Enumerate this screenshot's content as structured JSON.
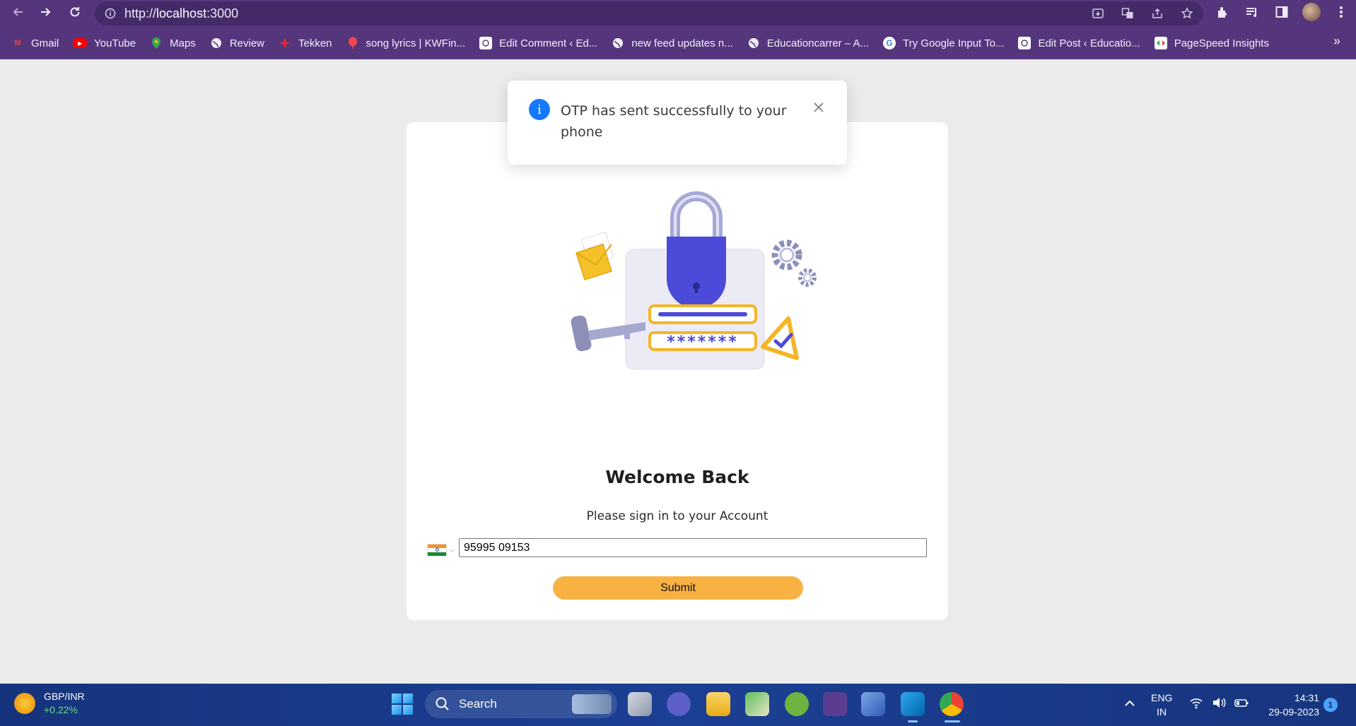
{
  "browser": {
    "url_scheme": "http://",
    "url_host": "localhost",
    "url_port": ":3000",
    "bookmarks": [
      {
        "label": "Gmail",
        "icon": "gmail-icon",
        "color": "#ea4335"
      },
      {
        "label": "YouTube",
        "icon": "youtube-icon",
        "color": "#ff0000"
      },
      {
        "label": "Maps",
        "icon": "maps-icon",
        "color": "#34a853"
      },
      {
        "label": "Review",
        "icon": "globe-icon",
        "color": "#ffffff"
      },
      {
        "label": "Tekken",
        "icon": "tekken-icon",
        "color": "#e3262e"
      },
      {
        "label": "song lyrics | KWFin...",
        "icon": "kwfinder-icon",
        "color": "#f2474f"
      },
      {
        "label": "Edit Comment ‹ Ed...",
        "icon": "site-icon",
        "color": "#ffffff"
      },
      {
        "label": "new feed updates n...",
        "icon": "globe-icon",
        "color": "#ffffff"
      },
      {
        "label": "Educationcarrer – A...",
        "icon": "globe-icon",
        "color": "#ffffff"
      },
      {
        "label": "Try Google Input To...",
        "icon": "google-icon",
        "color": "#ffffff"
      },
      {
        "label": "Edit Post ‹ Educatio...",
        "icon": "site-icon",
        "color": "#ffffff"
      },
      {
        "label": "PageSpeed Insights",
        "icon": "pagespeed-icon",
        "color": "#ffffff"
      }
    ],
    "more_label": "»"
  },
  "toast": {
    "message": "OTP has sent successfully to your phone",
    "icon": "info-icon",
    "accent": "#1677ff"
  },
  "login": {
    "title": "Welcome Back",
    "subtitle": "Please sign in to your Account",
    "country_flag": "india-flag-icon",
    "phone_value": "95995 09153",
    "submit_label": "Submit",
    "submit_color": "#f8b244"
  },
  "taskbar": {
    "widget_title": "GBP/INR",
    "widget_change": "+0.22%",
    "search_label": "Search",
    "lang_line1": "ENG",
    "lang_line2": "IN",
    "time": "14:31",
    "date": "29-09-2023",
    "notification_count": "1"
  }
}
